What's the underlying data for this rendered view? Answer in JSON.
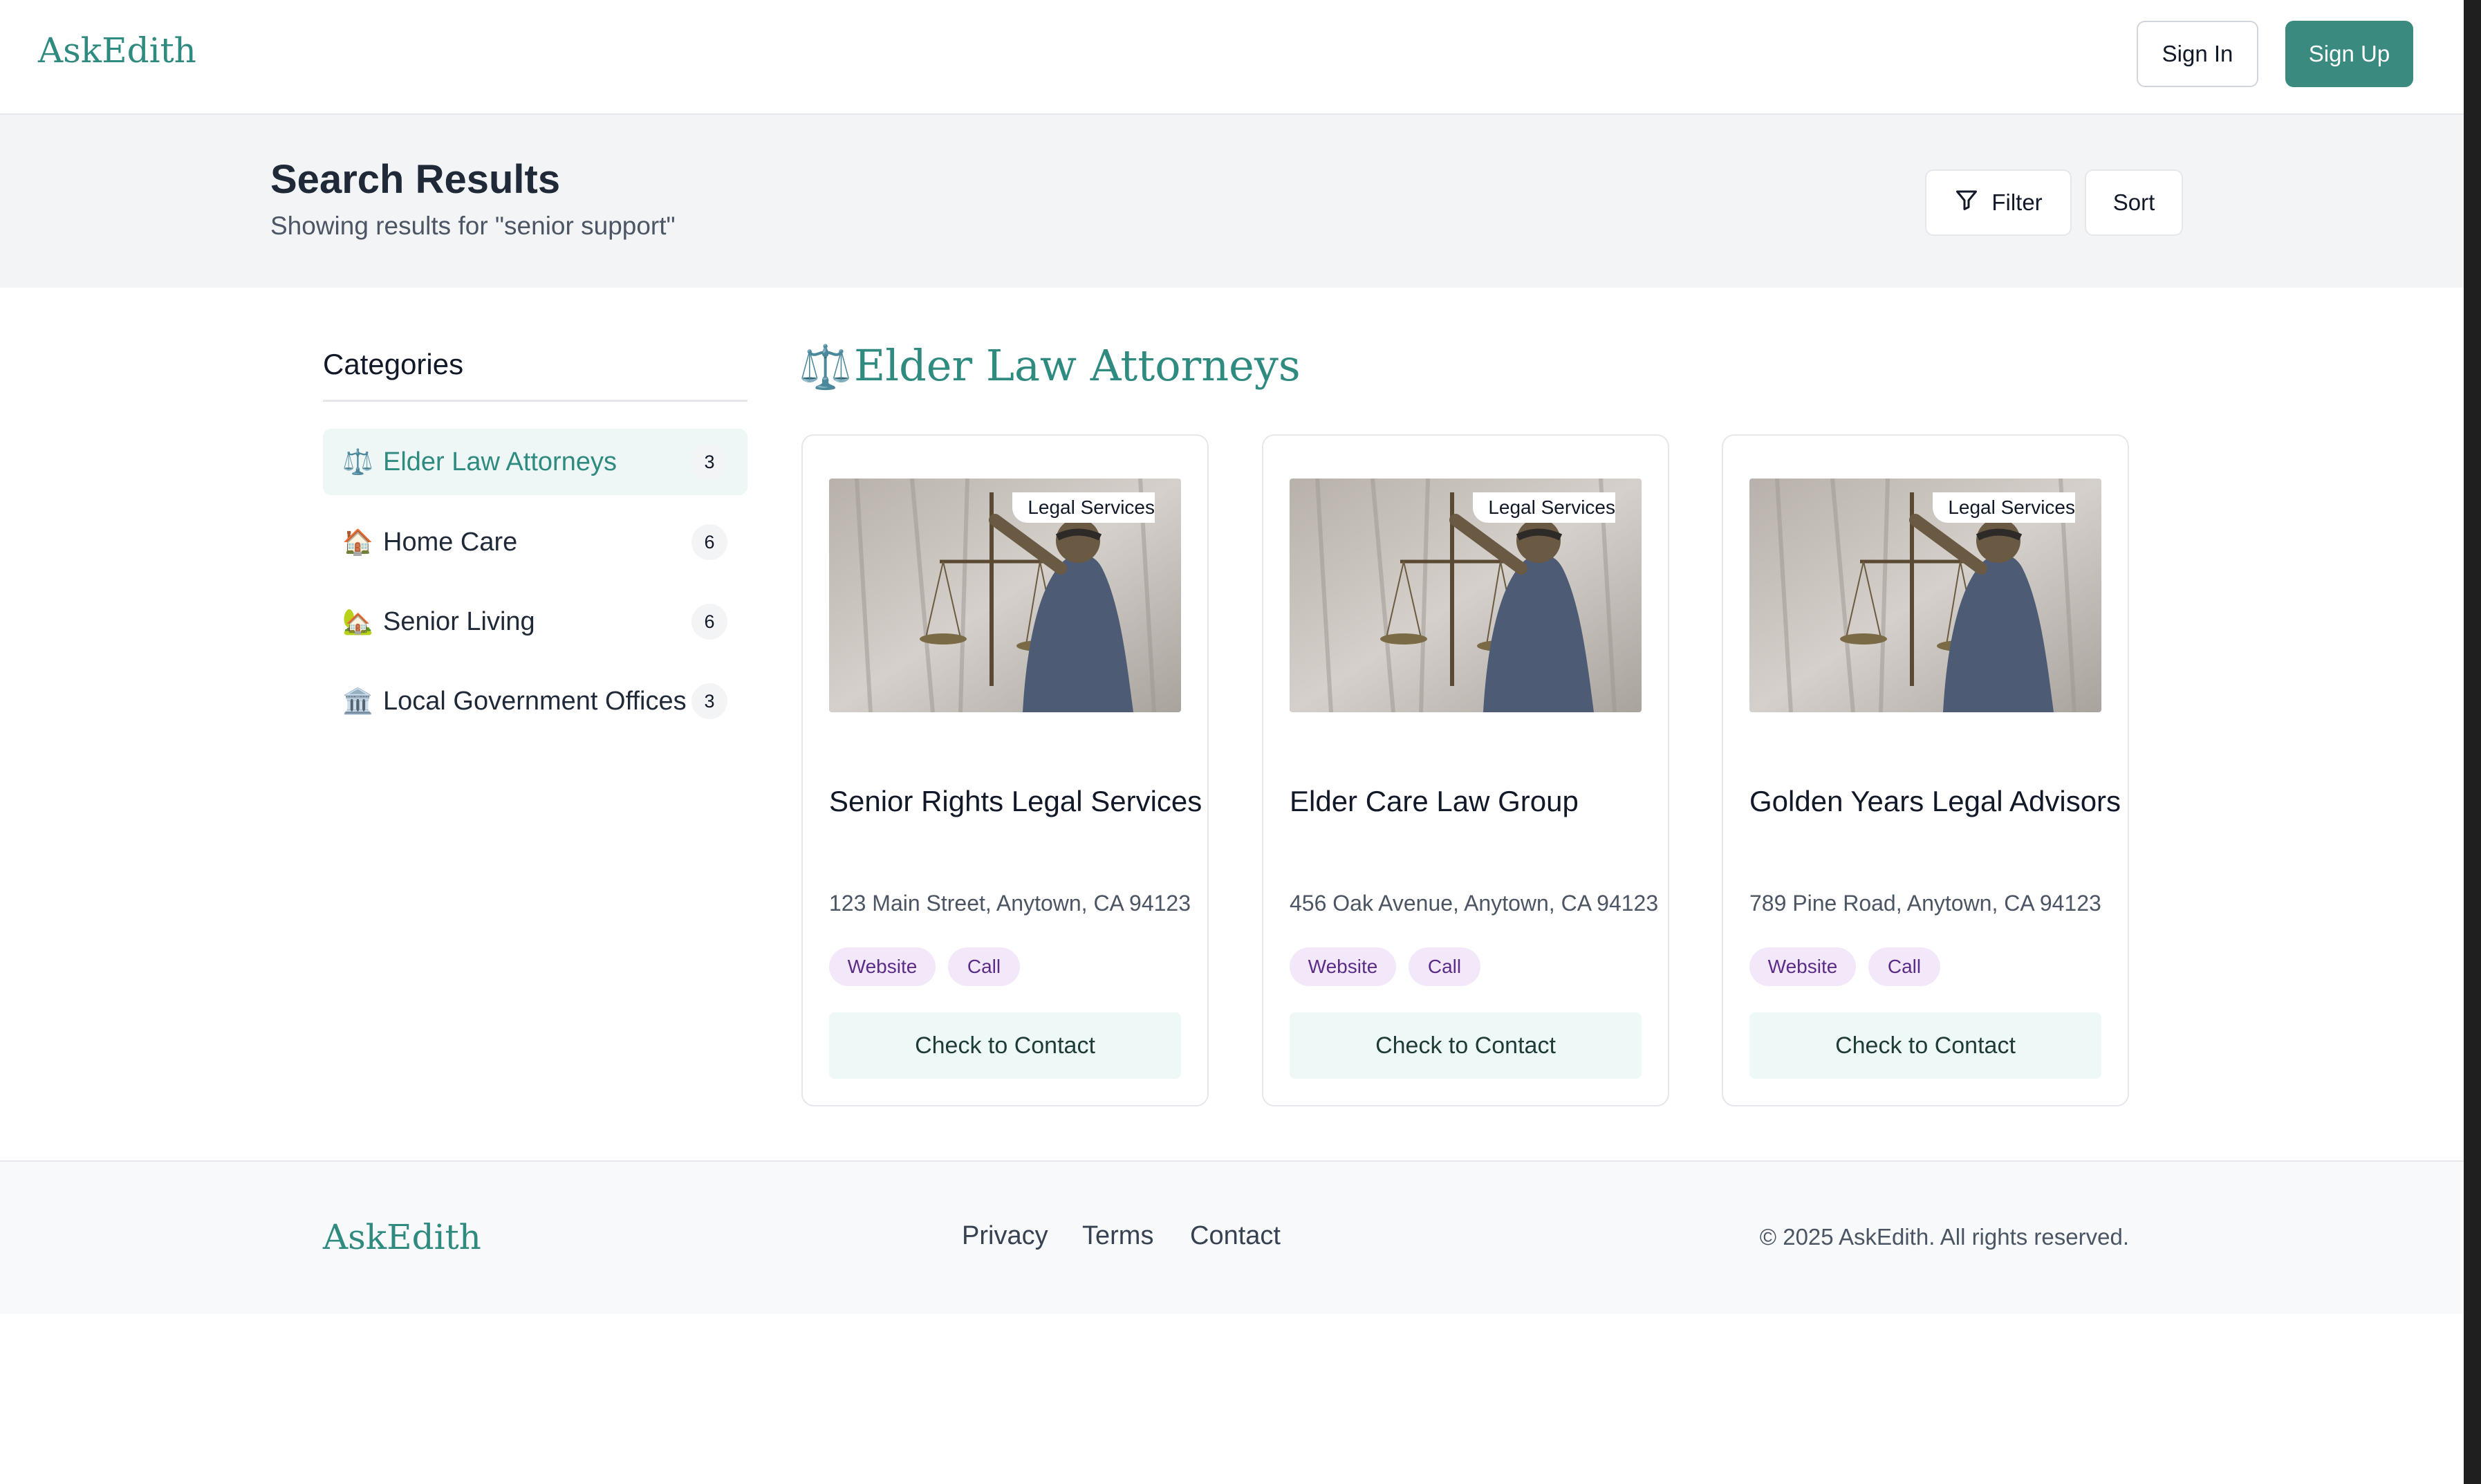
{
  "header": {
    "logo": "AskEdith",
    "sign_in": "Sign In",
    "sign_up": "Sign Up"
  },
  "results": {
    "title": "Search Results",
    "subtitle": "Showing results for \"senior support\"",
    "filter_label": "Filter",
    "sort_label": "Sort"
  },
  "sidebar": {
    "title": "Categories",
    "items": [
      {
        "icon": "⚖️",
        "icon_name": "scales-icon",
        "label": "Elder Law Attorneys",
        "count": "3",
        "active": true
      },
      {
        "icon": "🏠",
        "icon_name": "house-icon",
        "label": "Home Care",
        "count": "6",
        "active": false
      },
      {
        "icon": "🏡",
        "icon_name": "house-garden-icon",
        "label": "Senior Living",
        "count": "6",
        "active": false
      },
      {
        "icon": "🏛️",
        "icon_name": "government-building-icon",
        "label": "Local Government Offices",
        "count": "3",
        "active": false
      }
    ]
  },
  "section": {
    "icon": "⚖️",
    "title": "Elder Law Attorneys"
  },
  "cards": [
    {
      "tag": "Legal Services",
      "name": "Senior Rights Legal Services",
      "address": "123 Main Street, Anytown, CA 94123",
      "website": "Website",
      "call": "Call",
      "contact": "Check to Contact"
    },
    {
      "tag": "Legal Services",
      "name": "Elder Care Law Group",
      "address": "456 Oak Avenue, Anytown, CA 94123",
      "website": "Website",
      "call": "Call",
      "contact": "Check to Contact"
    },
    {
      "tag": "Legal Services",
      "name": "Golden Years Legal Advisors",
      "address": "789 Pine Road, Anytown, CA 94123",
      "website": "Website",
      "call": "Call",
      "contact": "Check to Contact"
    }
  ],
  "footer": {
    "logo": "AskEdith",
    "links": [
      "Privacy",
      "Terms",
      "Contact"
    ],
    "copyright": "© 2025 AskEdith. All rights reserved."
  },
  "colors": {
    "brand": "#2f8a80",
    "brand_button": "#3a8a80",
    "pill_bg": "#f3e8fa",
    "pill_text": "#5b2c87",
    "contact_bg": "#eef8f6"
  }
}
